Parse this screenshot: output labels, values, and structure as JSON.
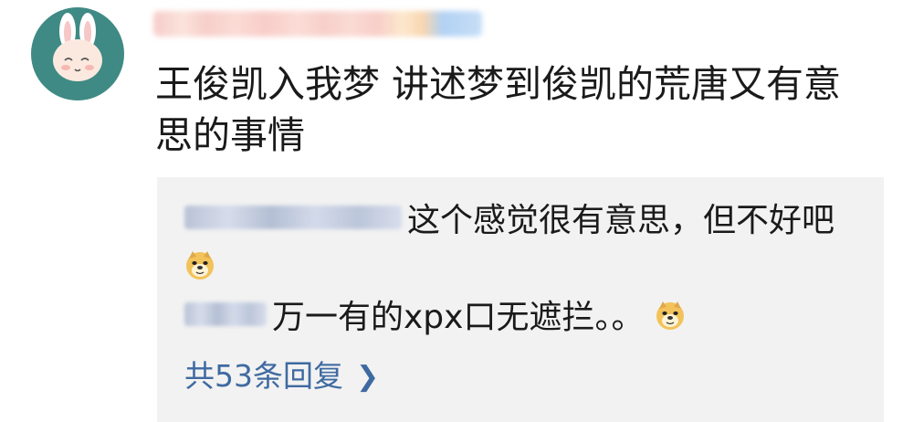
{
  "comment": {
    "username": "",
    "text": "王俊凯入我梦 讲述梦到俊凯的荒唐又有意思的事情"
  },
  "replies": [
    {
      "username": "",
      "text": "这个感觉很有意思，但不好吧",
      "emoji": "doge-emoji"
    },
    {
      "username": "",
      "text": "万一有的xpx口无遮拦。。",
      "emoji": "doge-emoji"
    }
  ],
  "view_all": {
    "label": "共53条回复",
    "icon": "chevron-right-icon"
  },
  "colors": {
    "avatar_bg": "#3f8a84",
    "reply_bg": "#f2f2f2",
    "link": "#3f6aa1"
  }
}
